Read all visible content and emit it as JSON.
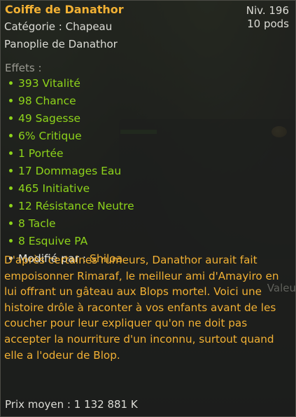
{
  "item": {
    "name": "Coiffe de Danathor",
    "level": "Niv. 196",
    "weight": "10 pods",
    "category": "Catégorie : Chapeau",
    "set": "Panoplie de Danathor"
  },
  "effects": {
    "title": "Effets :",
    "list": [
      "393 Vitalité",
      "98 Chance",
      "49 Sagesse",
      "6% Critique",
      "1 Portée",
      "17 Dommages Eau",
      "465 Initiative",
      "12 Résistance Neutre",
      "8 Tacle",
      "8 Esquive PA"
    ],
    "modified_by_label": "Modifié par :",
    "modified_by_name": "Shiloa"
  },
  "description": "D'après certaines rumeurs, Danathor aurait fait empoisonner Rimaraf, le meilleur ami d'Amayiro en lui offrant un gâteau aux Blops mortel. Voici une histoire drôle à raconter à vos enfants avant de les coucher pour leur expliquer qu'on ne doit pas accepter la nourriture d'un inconnu, surtout quand elle a l'odeur de Blop.",
  "price": "Prix moyen : 1 132 881 K",
  "background": {
    "partial_label": "Valeu"
  },
  "colors": {
    "title": "#f2b134",
    "effect": "#8ed41b",
    "text": "#dcdcd6",
    "muted": "#9b9a92"
  }
}
